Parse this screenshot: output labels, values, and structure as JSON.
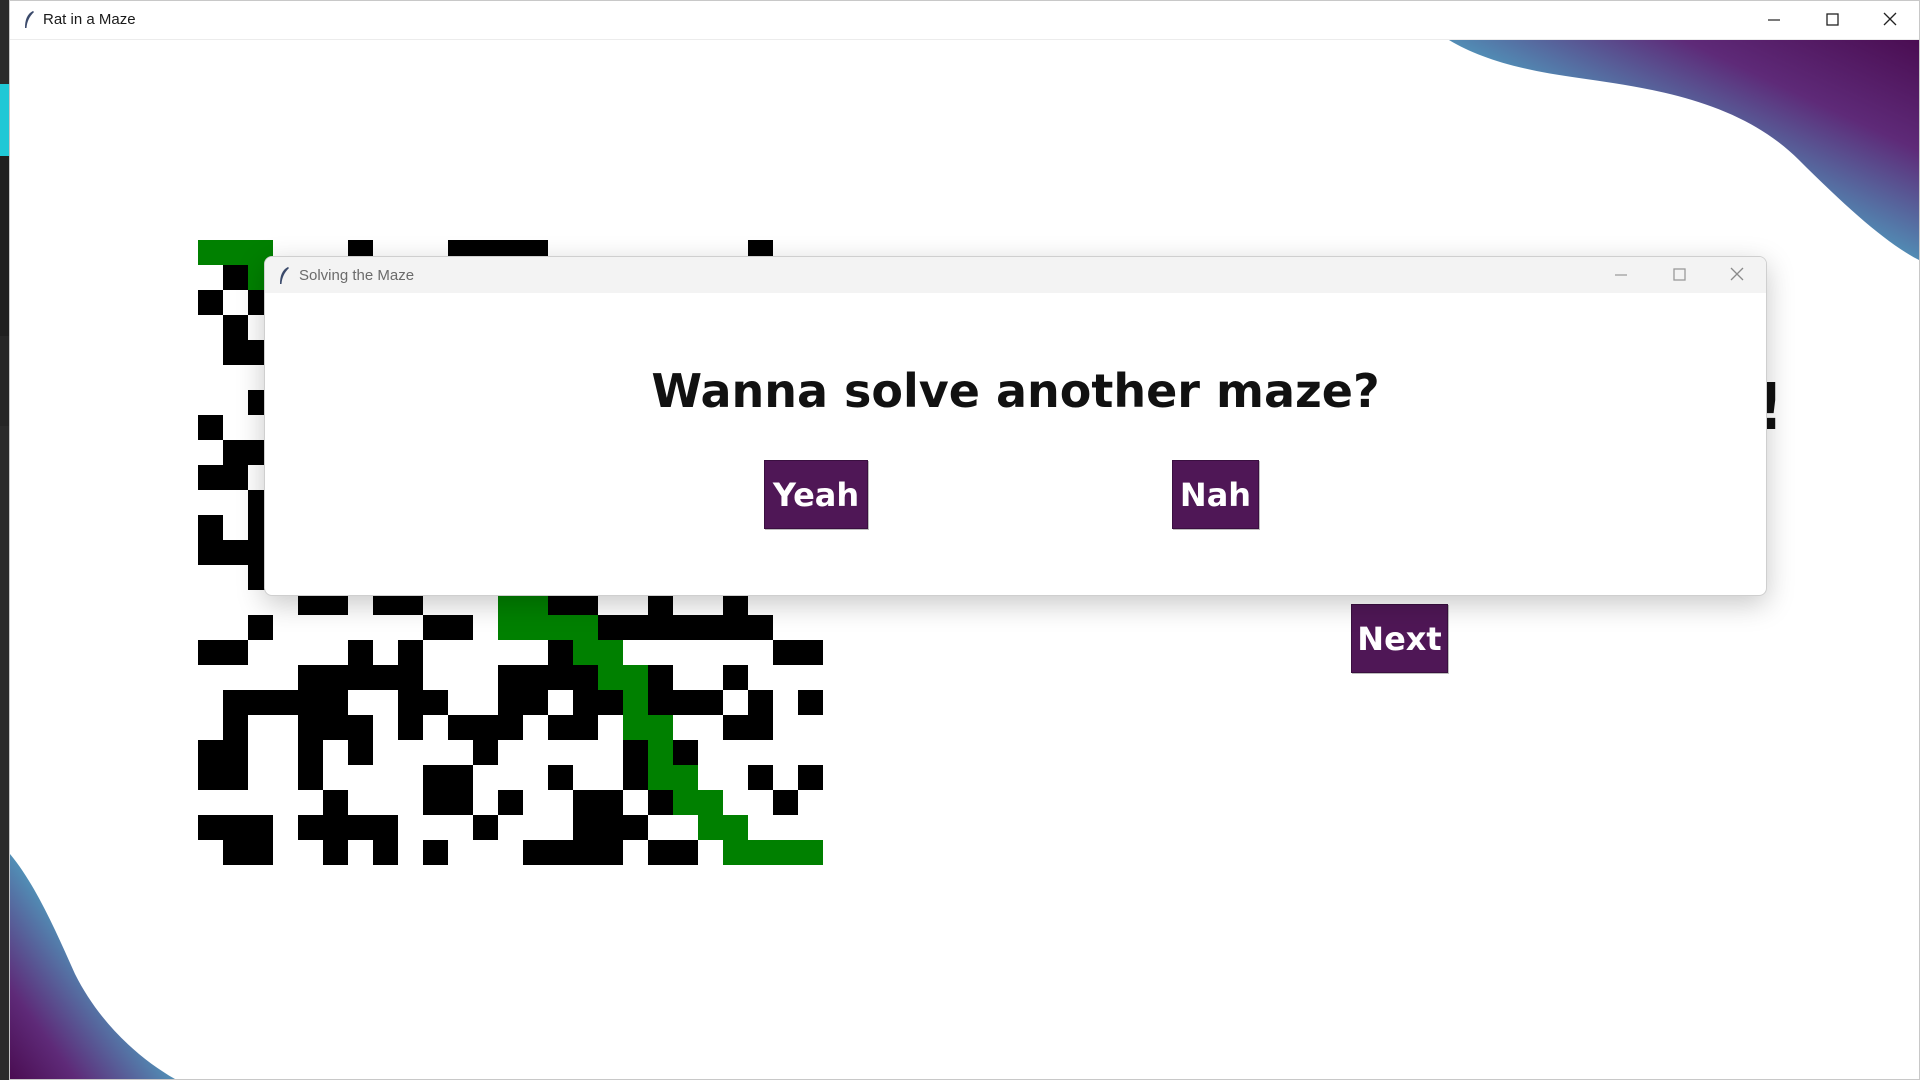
{
  "window": {
    "title": "Rat in a Maze",
    "app_icon": "feather-icon",
    "controls": [
      "minimize-icon",
      "maximize-icon",
      "close-icon"
    ]
  },
  "main": {
    "headline_visible_fragment": "!",
    "next_label": "Next"
  },
  "maze": {
    "rows": 25,
    "cols": 25,
    "wall_color": "#000000",
    "open_color": "#ffffff",
    "path_color": "#008000"
  },
  "dialog": {
    "title": "Solving the Maze",
    "app_icon": "feather-icon",
    "question": "Wanna solve another maze?",
    "yes_label": "Yeah",
    "no_label": "Nah"
  },
  "colors": {
    "button_bg": "#4f1756",
    "wave_dark": "#4a0d52",
    "wave_light": "#58b6c8"
  }
}
